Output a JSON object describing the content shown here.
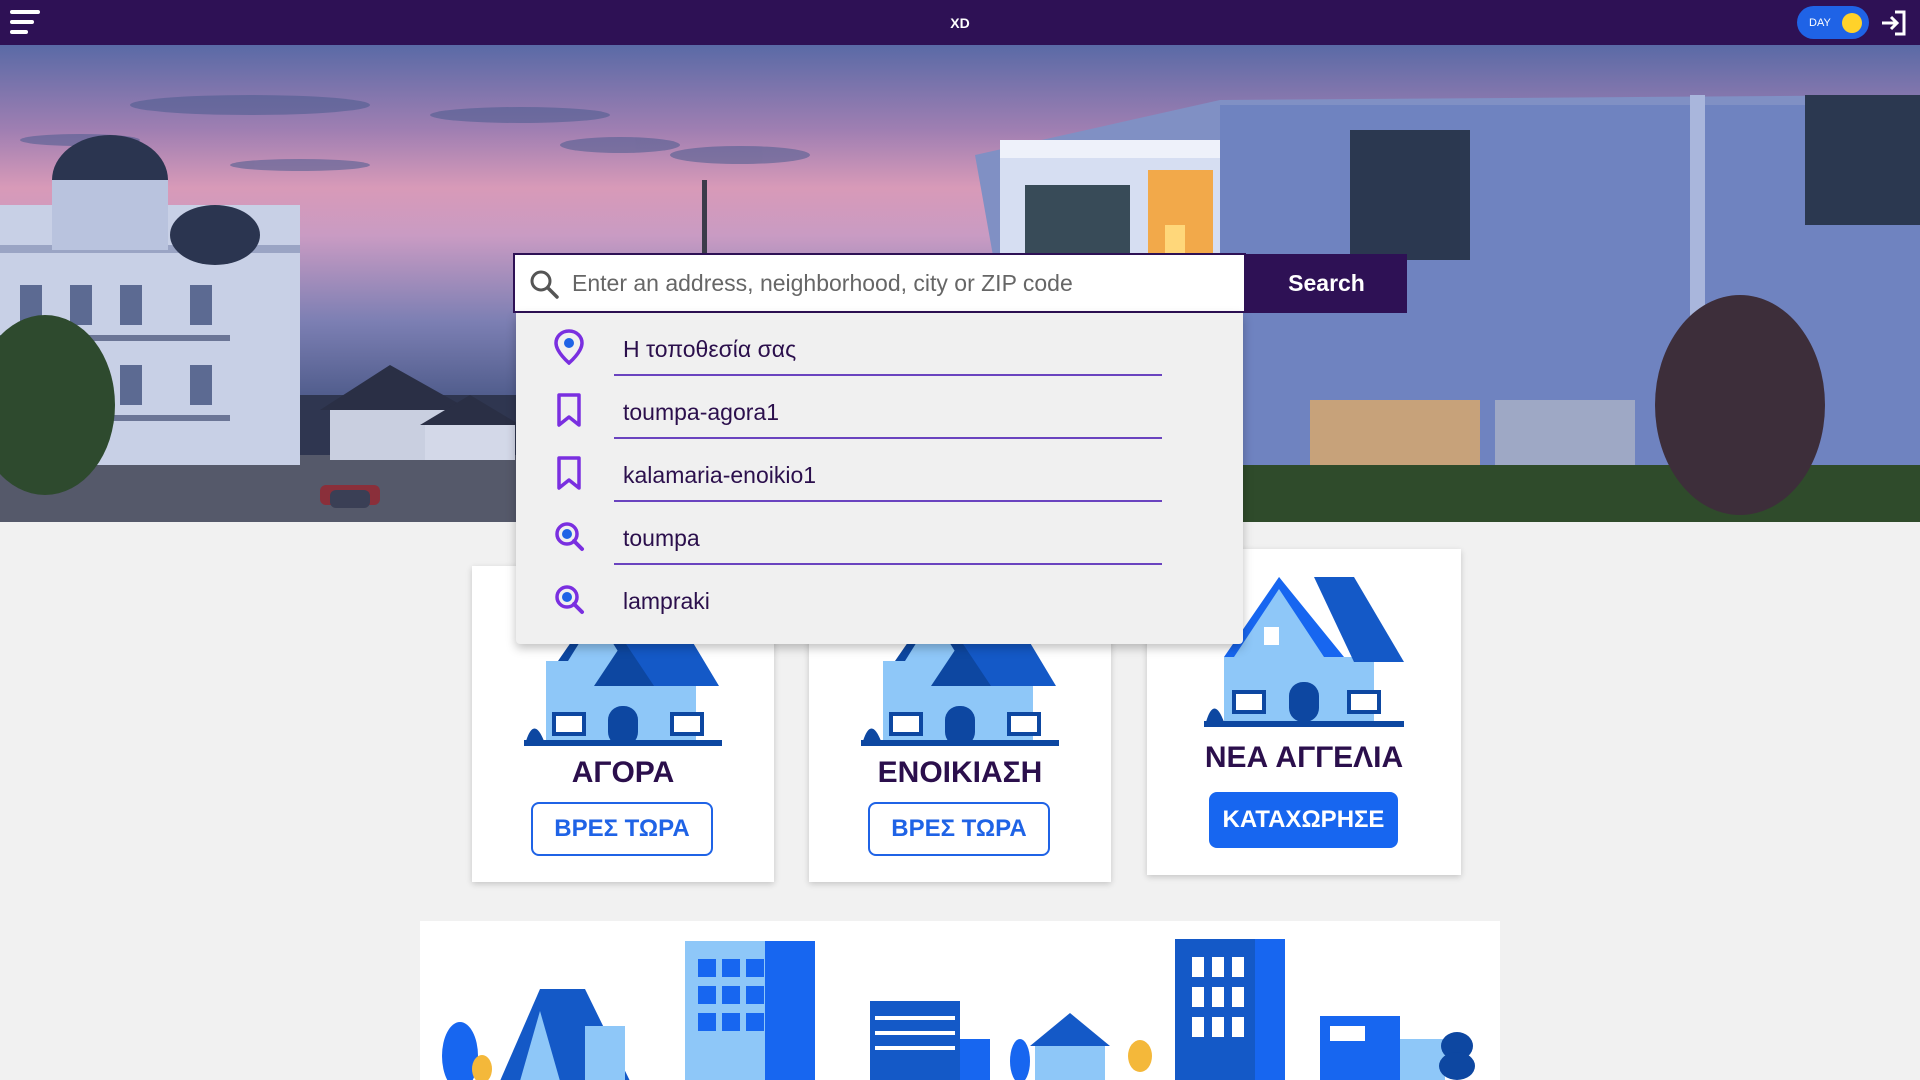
{
  "header": {
    "brand": "XD",
    "menu_icon": "hamburger-menu-icon",
    "theme_toggle": {
      "label": "DAY",
      "knob_color": "#ffd22a",
      "track_color": "#1f63e6"
    },
    "login_icon": "login-icon",
    "background": "#2e1155"
  },
  "search": {
    "placeholder": "Enter an address, neighborhood, city or ZIP code",
    "value": "",
    "button_label": "Search",
    "icon": "search-icon"
  },
  "suggestions": [
    {
      "icon": "location-pin-icon",
      "label": "Η τοποθεσία σας"
    },
    {
      "icon": "bookmark-icon",
      "label": "toumpa-agora1"
    },
    {
      "icon": "bookmark-icon",
      "label": "kalamaria-enoikio1"
    },
    {
      "icon": "search-history-icon",
      "label": "toumpa"
    },
    {
      "icon": "search-history-icon",
      "label": "lampraki"
    }
  ],
  "cards": [
    {
      "title": "ΑΓΟΡΑ",
      "button_label": "ΒΡΕΣ ΤΩΡΑ",
      "icon": "house-icon"
    },
    {
      "title": "ΕΝΟΙΚΙΑΣΗ",
      "button_label": "ΒΡΕΣ ΤΩΡΑ",
      "icon": "house-icon"
    },
    {
      "title": "ΝΕΑ ΑΓΓΕΛΙΑ",
      "button_label": "ΚΑΤΑΧΩΡΗΣΕ",
      "icon": "house-icon"
    }
  ],
  "colors": {
    "accent": "#1f63e6",
    "primary_dark": "#2e1155",
    "suggestion_divider": "#6a43bf",
    "icon_purple": "#7a2fe0"
  }
}
